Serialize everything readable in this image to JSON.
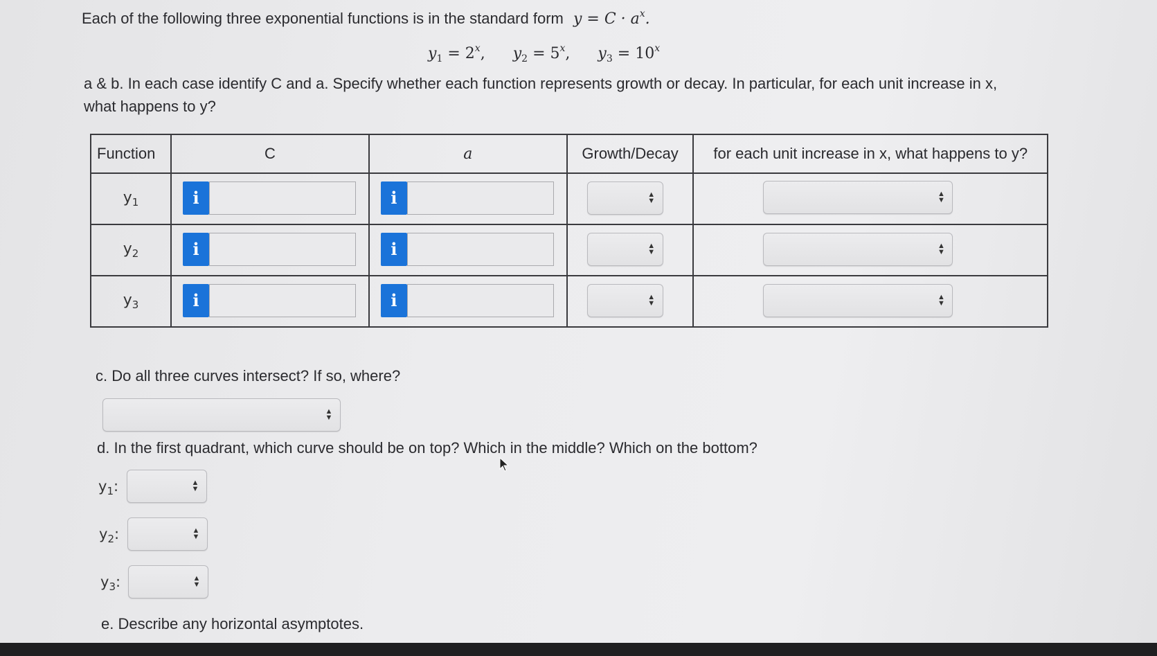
{
  "intro": {
    "text": "Each of the following three exponential functions is in the standard form",
    "form": "y = C · a",
    "form_exp": "x",
    "period": "."
  },
  "equations": [
    {
      "lhs": "y",
      "sub": "1",
      "rhs": "= 2",
      "exp": "x",
      "sep": ","
    },
    {
      "lhs": "y",
      "sub": "2",
      "rhs": "= 5",
      "exp": "x",
      "sep": ","
    },
    {
      "lhs": "y",
      "sub": "3",
      "rhs": "= 10",
      "exp": "x",
      "sep": ""
    }
  ],
  "question_ab": {
    "line1": "a & b. In each case identify C and a. Specify whether each function represents growth or decay. In particular, for each unit increase in x,",
    "line2": "what happens to y?"
  },
  "table": {
    "headers": [
      "Function",
      "C",
      "a",
      "Growth/Decay",
      "for each unit increase in x, what happens to y?"
    ],
    "rows": [
      {
        "func": "y",
        "sub": "1",
        "info_c": "i",
        "info_a": "i"
      },
      {
        "func": "y",
        "sub": "2",
        "info_c": "i",
        "info_a": "i"
      },
      {
        "func": "y",
        "sub": "3",
        "info_c": "i",
        "info_a": "i"
      }
    ]
  },
  "question_c": "c. Do all three curves intersect? If so, where?",
  "question_d": "d. In the first quadrant, which curve should be on top? Which in the middle? Which on the bottom?",
  "d_labels": [
    {
      "y": "y",
      "sub": "1",
      "colon": ":"
    },
    {
      "y": "y",
      "sub": "2",
      "colon": ":"
    },
    {
      "y": "y",
      "sub": "3",
      "colon": ":"
    }
  ],
  "question_e": "e. Describe any horizontal asymptotes.",
  "icons": {
    "info": "info-icon",
    "select_arrows": "updown-arrows-icon"
  },
  "colors": {
    "info_button": "#1a73d9"
  }
}
